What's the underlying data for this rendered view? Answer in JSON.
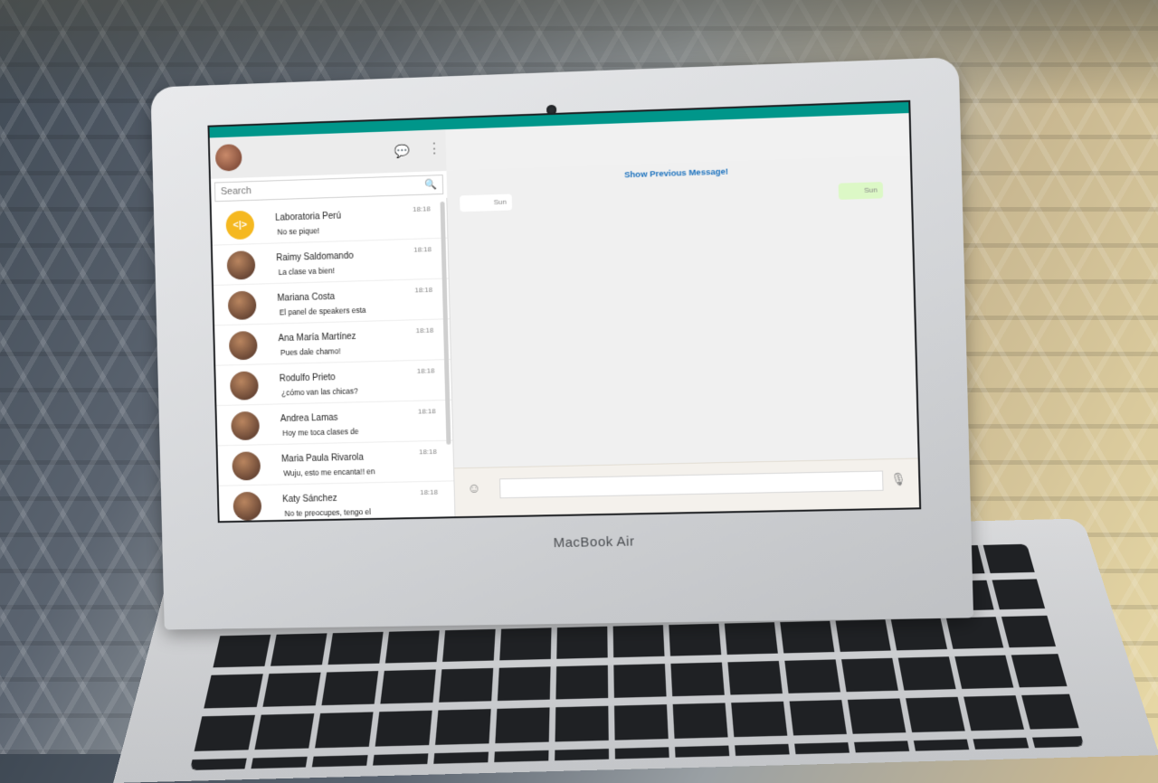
{
  "device": {
    "brand_label": "MacBook Air"
  },
  "sidebar": {
    "search": {
      "placeholder": "Search"
    },
    "chats": [
      {
        "name": "Laboratoria Perú",
        "preview": "No se pique!",
        "time": "18:18",
        "avatar": "logo",
        "logo_text": "<|>"
      },
      {
        "name": "Raimy Saldomando",
        "preview": "La clase va bien!",
        "time": "18:18",
        "avatar": "photo"
      },
      {
        "name": "Mariana Costa",
        "preview": "El panel de speakers esta",
        "time": "18:18",
        "avatar": "photo"
      },
      {
        "name": "Ana María Martínez",
        "preview": "Pues dale chamo!",
        "time": "18:18",
        "avatar": "photo"
      },
      {
        "name": "Rodulfo Prieto",
        "preview": "¿cómo van las chicas?",
        "time": "18:18",
        "avatar": "photo"
      },
      {
        "name": "Andrea Lamas",
        "preview": "Hoy me toca clases de",
        "time": "18:18",
        "avatar": "photo"
      },
      {
        "name": "Maria Paula Rivarola",
        "preview": "Wuju, esto me encanta!! en",
        "time": "18:18",
        "avatar": "photo"
      },
      {
        "name": "Katy Sánchez",
        "preview": "No te preocupes, tengo el",
        "time": "18:18",
        "avatar": "photo"
      }
    ]
  },
  "conversation": {
    "show_previous_label": "Show Previous Message!",
    "incoming_time": "Sun",
    "outgoing_time": "Sun"
  },
  "icons": {
    "chat": "chat-bubbles-icon",
    "menu": "vertical-dots-icon",
    "search": "magnifier-icon",
    "emoji": "smiley-icon",
    "mic": "microphone-icon",
    "send": "paper-plane-icon"
  },
  "colors": {
    "accent": "#00968a",
    "link": "#1e73be",
    "outgoing_bubble": "#dcf8c6",
    "logo": "#f5b820"
  }
}
